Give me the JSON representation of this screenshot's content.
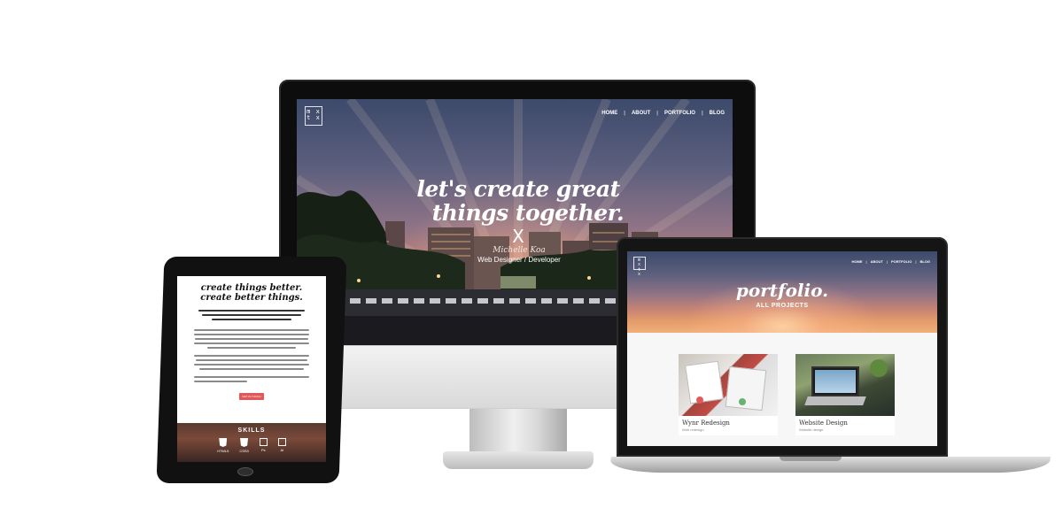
{
  "monitor_site": {
    "logo": {
      "line1": "m x",
      "line2": "t x"
    },
    "nav": [
      "HOME",
      "ABOUT",
      "PORTFOLIO",
      "BLOG"
    ],
    "hero_line1": "let's create great",
    "hero_line2": "things together.",
    "x_mark": "X",
    "name": "Michelle Koa",
    "role": "Web Designer / Developer"
  },
  "laptop_site": {
    "logo": {
      "line1": "m x",
      "line2": "t x"
    },
    "nav": [
      "HOME",
      "ABOUT",
      "PORTFOLIO",
      "BLOG"
    ],
    "heading": "portfolio.",
    "subheading": "ALL PROJECTS",
    "cards": [
      {
        "title": "Wynr Redesign",
        "subtitle": "Web redesign"
      },
      {
        "title": "Website Design",
        "subtitle": "Website design"
      }
    ]
  },
  "tablet_site": {
    "heading_line1": "create things better.",
    "heading_line2": "create better things.",
    "button_label": "GET IN TOUCH",
    "skills_title": "SKILLS",
    "skills": [
      "HTML5",
      "CSS3",
      "Ps",
      "Ai"
    ]
  },
  "colors": {
    "accent_button": "#e0595a",
    "sky_top": "#3d4a6b",
    "sky_bottom": "#f0b07a"
  }
}
